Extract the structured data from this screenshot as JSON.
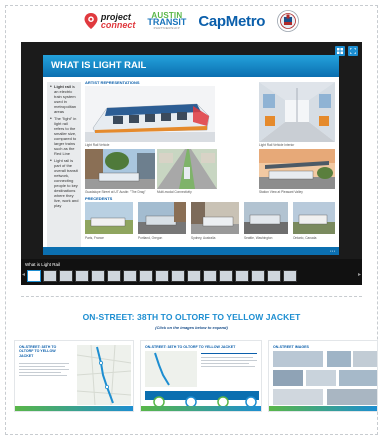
{
  "logos": {
    "project_connect_line1": "project",
    "project_connect_line2": "connect",
    "atp_line1": "AUSTIN",
    "atp_line2": "TRANSIT",
    "atp_line3": "PARTNERSHIP",
    "capmetro": "CapMetro"
  },
  "slide": {
    "title": "WHAT IS LIGHT RAIL",
    "artist_label": "ARTIST REPRESENTATIONS",
    "precedents_label": "PRECEDENTS",
    "bullets": [
      {
        "bold": "Light rail",
        "text": " is an electric train system used in metropolitan areas"
      },
      {
        "bold": "",
        "text": "The \"light\" in light rail refers to the smaller size, compared to larger trains such as the Red Line"
      },
      {
        "bold": "",
        "text": "Light rail is part of the overall transit network, connecting people to key destinations where they live, work and play"
      }
    ],
    "captions": {
      "vehicle": "Light Rail Vehicle",
      "interior": "Light Rail Vehicle Interior",
      "guadalupe": "Guadalupe Street at UT Austin: \"The Drag\"",
      "multimodal": "Multi-modal Connectivity",
      "station": "Station View at Pleasant Valley",
      "paris": "Paris, France",
      "portland": "Portland, Oregon",
      "sydney": "Sydney, Australia",
      "seattle": "Seattle, Washington",
      "ontario": "Ontario, Canada"
    }
  },
  "film_strip": {
    "label": "What is Light Rail",
    "thumb_count": 17,
    "active_index": 0
  },
  "section": {
    "title": "ON-STREET: 38TH TO OLTORF TO YELLOW JACKET",
    "subtitle": "(Click on the images below to expand)"
  },
  "cards": [
    {
      "title_line1": "ON-STREET: 38TH TO",
      "title_line2": "OLTORF TO YELLOW",
      "title_line3": "JACKET"
    },
    {
      "title_line1": "ON-STREET: 38TH TO OLTORF TO YELLOW JACKET"
    },
    {
      "title_line1": "ON-STREET IMAGES"
    }
  ],
  "colors": {
    "accent": "#1d8ed1",
    "header_dark": "#0b6fb0",
    "green": "#59b648",
    "viewer_bg": "#1b1b1b"
  }
}
